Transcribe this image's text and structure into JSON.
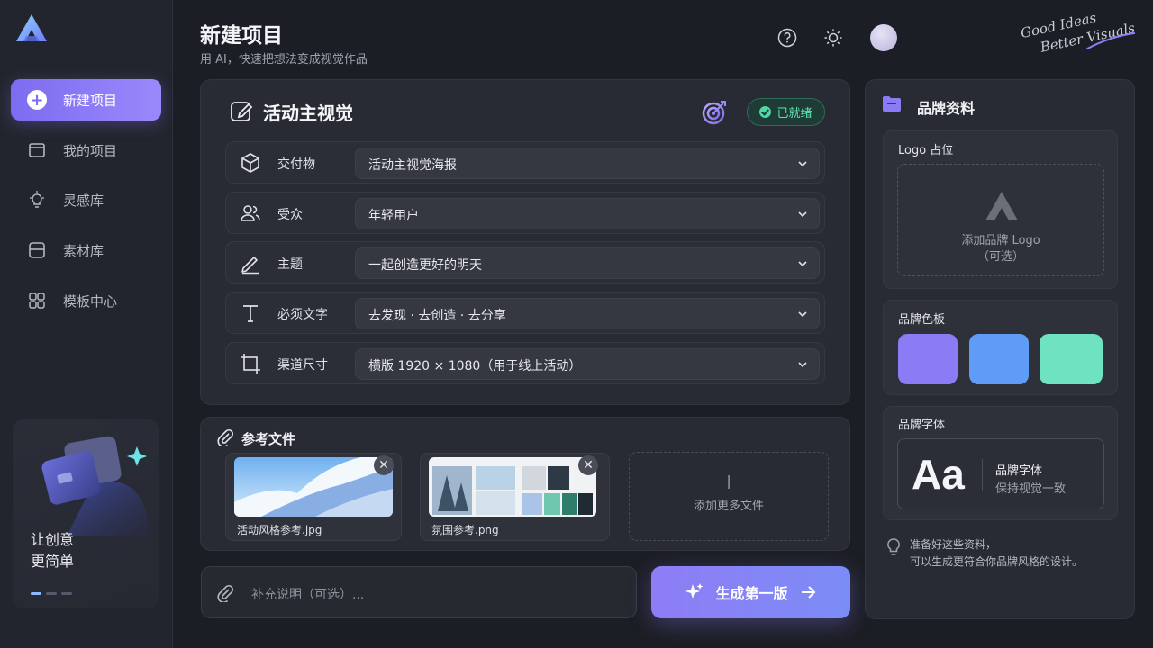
{
  "sidebar": {
    "items": [
      {
        "label": "新建项目",
        "icon": "plus-circle-icon"
      },
      {
        "label": "我的项目",
        "icon": "folder-icon"
      },
      {
        "label": "灵感库",
        "icon": "lightbulb-icon"
      },
      {
        "label": "素材库",
        "icon": "asset-box-icon"
      },
      {
        "label": "模板中心",
        "icon": "template-icon"
      }
    ],
    "promo": {
      "line1": "让创意",
      "line2": "更简单"
    }
  },
  "header": {
    "title": "新建项目",
    "subtitle": "用 AI，快速把想法变成视觉作品",
    "slogan_line1": "Good Ideas",
    "slogan_line2": "Better Visuals"
  },
  "campaign": {
    "title": "活动主视觉",
    "status": "已就绪",
    "fields": [
      {
        "label": "交付物",
        "value": "活动主视觉海报",
        "icon": "cube-icon"
      },
      {
        "label": "受众",
        "value": "年轻用户",
        "icon": "users-icon"
      },
      {
        "label": "主题",
        "value": "一起创造更好的明天",
        "icon": "pencil-icon"
      },
      {
        "label": "必须文字",
        "value": "去发现 · 去创造 · 去分享",
        "icon": "text-icon"
      },
      {
        "label": "渠道尺寸",
        "value": "横版 1920 × 1080（用于线上活动）",
        "icon": "crop-icon"
      }
    ]
  },
  "references": {
    "title": "参考文件",
    "files": [
      {
        "name": "活动风格参考.jpg"
      },
      {
        "name": "氛围参考.png"
      }
    ],
    "add_more": "添加更多文件",
    "close_glyph": "✕",
    "plus_glyph": "+"
  },
  "composer": {
    "placeholder": "补充说明（可选）...",
    "generate_label": "生成第一版"
  },
  "brand": {
    "title": "品牌资料",
    "logo_label": "Logo 占位",
    "logo_hint_line1": "添加品牌 Logo",
    "logo_hint_line2": "（可选）",
    "palette_label": "品牌色板",
    "palette": [
      "#8b7cf6",
      "#5f9cf7",
      "#6fe3c1"
    ],
    "font_label": "品牌字体",
    "font_sample": "Aa",
    "font_name": "品牌字体",
    "font_desc": "保持视觉一致",
    "tip_line1": "准备好这些资料，",
    "tip_line2": "可以生成更符合你品牌风格的设计。"
  },
  "colors": {
    "accent": "#7c6cf0",
    "ready": "#4fd8a5",
    "background": "#1c1e25"
  }
}
